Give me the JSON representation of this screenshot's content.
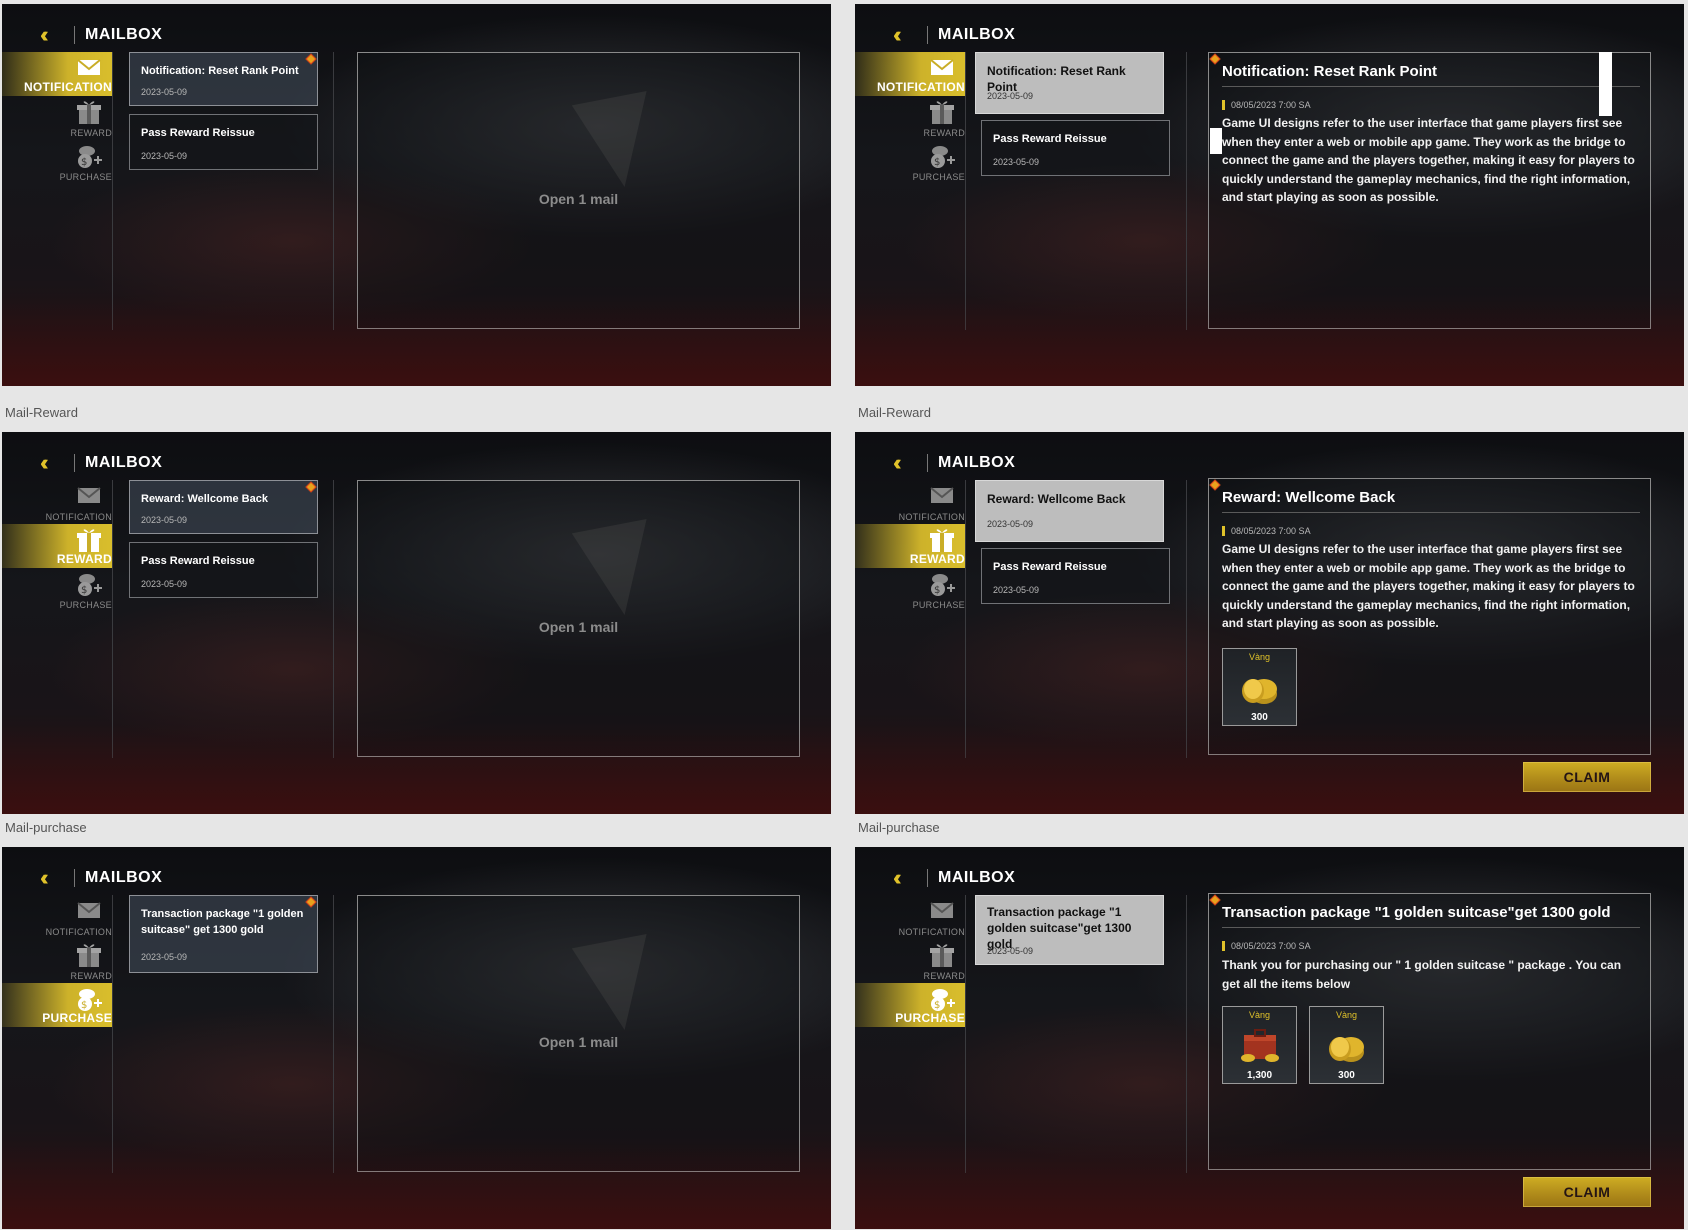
{
  "header": {
    "title": "MAILBOX"
  },
  "categories": [
    "NOTIFICATION",
    "REWARD",
    "PURCHASE"
  ],
  "captions": [
    "Mail-Reward",
    "Mail-Reward",
    "Mail-purchase",
    "Mail-purchase"
  ],
  "placeholder": "Open 1 mail",
  "mail": {
    "notification": {
      "title": "Notification: Reset Rank Point",
      "date": "2023-05-09"
    },
    "pass": {
      "title": "Pass Reward Reissue",
      "date": "2023-05-09"
    },
    "reward": {
      "title": "Reward: Wellcome Back",
      "date": "2023-05-09"
    },
    "purchase": {
      "title": "Transaction package \"1 golden suitcase\" get 1300 gold",
      "title_detail_list": "Transaction package \"1 golden suitcase\"get 1300 gold",
      "date": "2023-05-09"
    }
  },
  "detail": {
    "timestamp": "08/05/2023 7:00 SA",
    "body": "Game UI designs refer to the user interface that game players first see when they enter a web or mobile app game. They work as the bridge to connect the game and the players together, making it easy for players to quickly understand the gameplay mechanics, find the right information, and start playing as soon as possible.",
    "purchase_title": "Transaction package \"1 golden suitcase\"get 1300 gold",
    "purchase_body": "Thank you for purchasing our \" 1 golden suitcase \" package . You can get all the items below",
    "claim": "CLAIM"
  },
  "rewards": [
    {
      "name": "Vàng",
      "qty": "300"
    },
    {
      "name": "Vàng",
      "qty": "1,300"
    },
    {
      "name": "Vàng",
      "qty": "300"
    }
  ],
  "colors": {
    "accent": "#d9be2c",
    "background": "#121317",
    "badge": "#e8a21d"
  }
}
